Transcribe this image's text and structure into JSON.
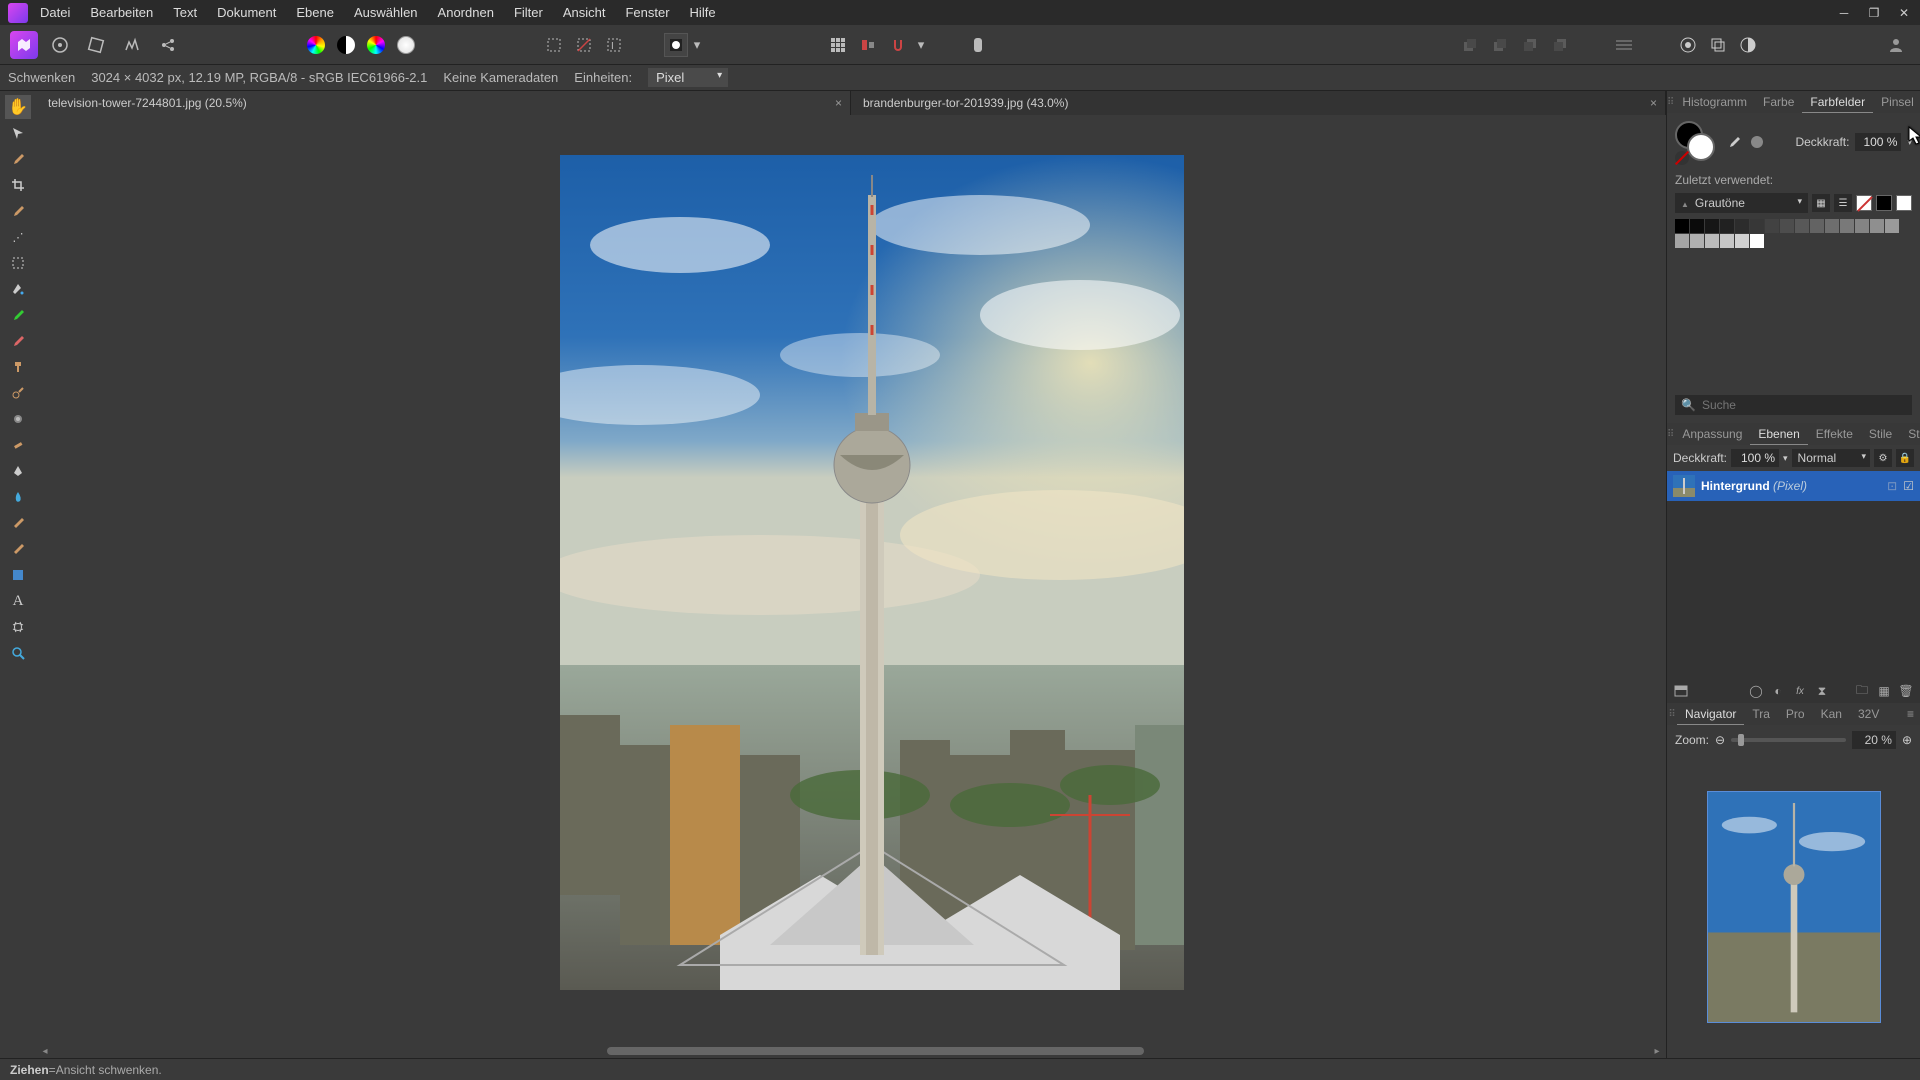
{
  "menu": [
    "Datei",
    "Bearbeiten",
    "Text",
    "Dokument",
    "Ebene",
    "Auswählen",
    "Anordnen",
    "Filter",
    "Ansicht",
    "Fenster",
    "Hilfe"
  ],
  "info": {
    "tool": "Schwenken",
    "dims": "3024 × 4032 px, 12.19 MP, RGBA/8 - sRGB IEC61966-2.1",
    "camera": "Keine Kameradaten",
    "units_label": "Einheiten:",
    "units_value": "Pixel"
  },
  "tabs": [
    {
      "label": "television-tower-7244801.jpg (20.5%)",
      "active": true
    },
    {
      "label": "brandenburger-tor-201939.jpg (43.0%)",
      "active": false
    }
  ],
  "colorPanel": {
    "tabs": [
      "Histogramm",
      "Farbe",
      "Farbfelder",
      "Pinsel"
    ],
    "activeTab": 2,
    "opacity_label": "Deckkraft:",
    "opacity_value": "100 %",
    "recent_label": "Zuletzt verwendet:",
    "palette_name": "Grautöne",
    "search_placeholder": "Suche"
  },
  "layersPanel": {
    "tabs": [
      "Anpassung",
      "Ebenen",
      "Effekte",
      "Stile",
      "Stock"
    ],
    "activeTab": 1,
    "opacity_label": "Deckkraft:",
    "opacity_value": "100 %",
    "blend_mode": "Normal",
    "layer": {
      "name": "Hintergrund",
      "type": "(Pixel)"
    }
  },
  "navPanel": {
    "tabs": [
      "Navigator",
      "Tra",
      "Pro",
      "Kan",
      "32V"
    ],
    "activeTab": 0,
    "zoom_label": "Zoom:",
    "zoom_value": "20 %"
  },
  "status": {
    "key": "Ziehen",
    "sep": " = ",
    "desc": "Ansicht schwenken."
  },
  "grays": [
    "#000000",
    "#0b0b0b",
    "#161616",
    "#212121",
    "#2c2c2c",
    "#373737",
    "#424242",
    "#4d4d4d",
    "#585858",
    "#636363",
    "#6e6e6e",
    "#797979",
    "#848484",
    "#8f8f8f",
    "#9a9a9a",
    "#a5a5a5",
    "#b0b0b0",
    "#bbbbbb",
    "#c6c6c6",
    "#d1d1d1",
    "#ffffff"
  ]
}
